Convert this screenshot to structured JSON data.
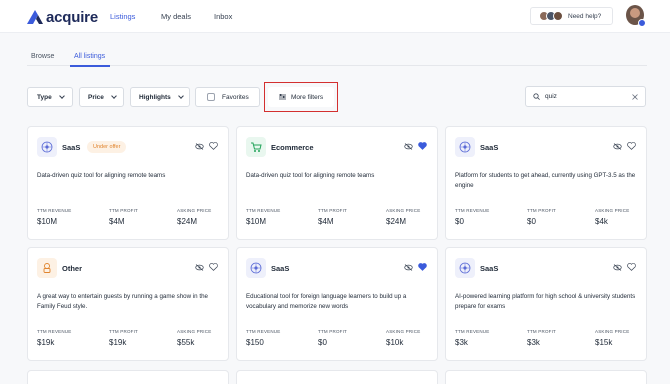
{
  "app": {
    "logo_text": "acquire"
  },
  "nav": {
    "items": [
      "Listings",
      "My deals",
      "Inbox"
    ]
  },
  "help": {
    "label": "Need help?"
  },
  "tabs": {
    "browse": "Browse",
    "all": "All listings"
  },
  "filters": {
    "type": "Type",
    "price": "Price",
    "highlights": "Highlights",
    "favorites": "Favorites",
    "more": "More filters"
  },
  "search": {
    "value": "quiz"
  },
  "metric_labels": {
    "revenue": "TTM REVENUE",
    "profit": "TTM PROFIT",
    "asking": "ASKING PRICE"
  },
  "listings": [
    {
      "category": "SaaS",
      "badge": "Under offer",
      "favorited": false,
      "icon": "saas-icon",
      "description": "Data-driven quiz tool for aligning remote teams",
      "revenue": "$10M",
      "profit": "$4M",
      "asking": "$24M"
    },
    {
      "category": "Ecommerce",
      "badge": "",
      "favorited": true,
      "icon": "cart-icon",
      "description": "Data-driven quiz tool for aligning remote teams",
      "revenue": "$10M",
      "profit": "$4M",
      "asking": "$24M"
    },
    {
      "category": "SaaS",
      "badge": "",
      "favorited": false,
      "icon": "saas-icon",
      "description": "Platform for students to get ahead, currently using GPT-3.5 as the engine",
      "revenue": "$0",
      "profit": "$0",
      "asking": "$4k"
    },
    {
      "category": "Other",
      "badge": "",
      "favorited": false,
      "icon": "other-icon",
      "description": "A great way to entertain guests by running a game show in the Family Feud style.",
      "revenue": "$19k",
      "profit": "$19k",
      "asking": "$55k"
    },
    {
      "category": "SaaS",
      "badge": "",
      "favorited": true,
      "icon": "saas-icon",
      "description": "Educational tool for foreign language learners to build up a vocabulary and memorize new words",
      "revenue": "$150",
      "profit": "$0",
      "asking": "$10k"
    },
    {
      "category": "SaaS",
      "badge": "",
      "favorited": false,
      "icon": "saas-icon",
      "description": "AI-powered learning platform for high school & university students prepare for exams",
      "revenue": "$3k",
      "profit": "$3k",
      "asking": "$15k"
    }
  ],
  "colors": {
    "accent": "#3b5bdb",
    "badge_bg": "#fdf1e4",
    "badge_text": "#e0842e",
    "highlight": "#d32f2f"
  }
}
